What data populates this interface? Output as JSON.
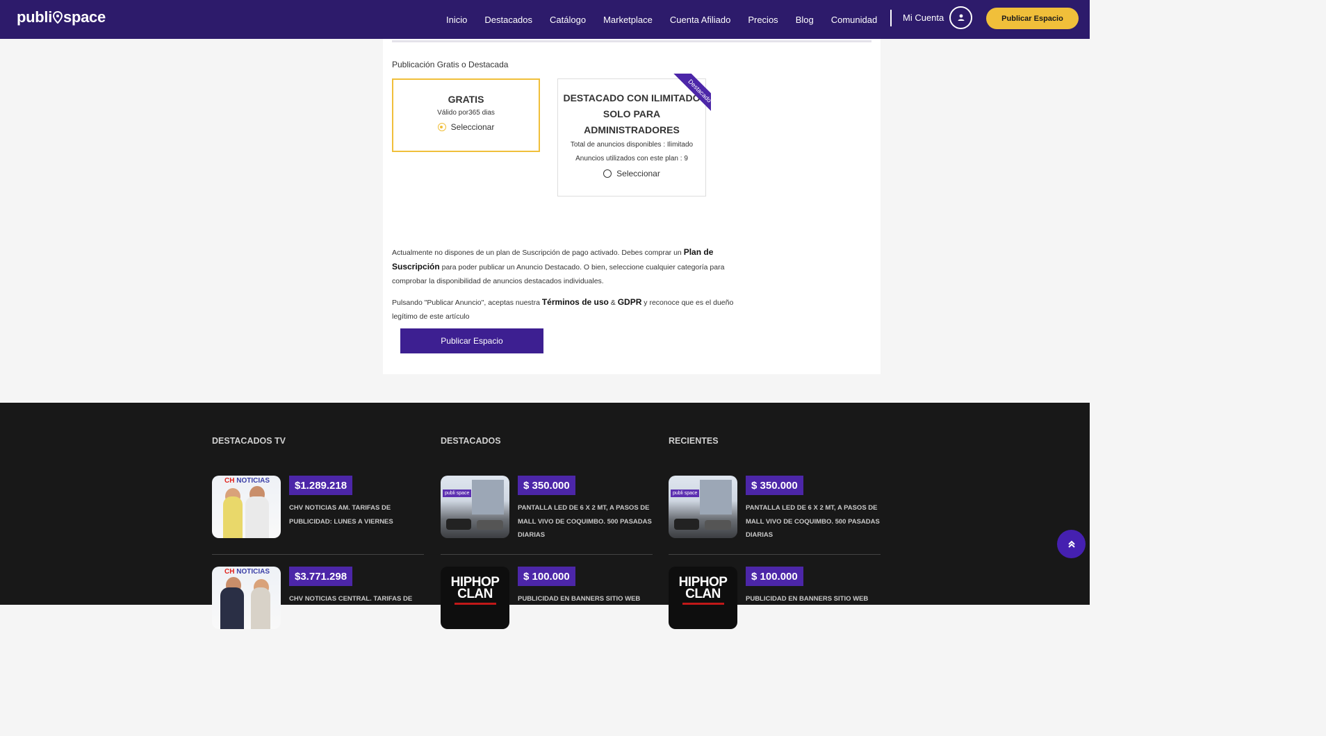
{
  "header": {
    "logo_left": "publi",
    "logo_right": "space",
    "nav": [
      "Inicio",
      "Destacados",
      "Catálogo",
      "Marketplace",
      "Cuenta Afiliado",
      "Precios",
      "Blog",
      "Comunidad"
    ],
    "account_label": "Mi Cuenta",
    "publish_button": "Publicar Espacio"
  },
  "form": {
    "section_label": "Publicación Gratis o Destacada",
    "plans": {
      "free": {
        "title": "GRATIS",
        "validity": "Válido por365 dias",
        "select_label": "Seleccionar",
        "selected": true
      },
      "featured": {
        "title": "DESTACADO CON  ILIMITADO SOLO PARA ADMINISTRADORES",
        "total_label": "Total de anuncios disponibles : Ilimitado",
        "used_label": "Anuncios utilizados con este plan : 9",
        "select_label": "Seleccionar",
        "selected": false,
        "ribbon": "Destacado"
      }
    },
    "notice_text_1": "Actualmente no dispones de un plan de Suscripción de pago activado. Debes comprar un ",
    "notice_link": "Plan de Suscripción",
    "notice_text_2": " para poder publicar un Anuncio Destacado. O bien, seleccione cualquier categoría para comprobar la disponibilidad de anuncios destacados individuales.",
    "terms_text_1": "Pulsando \"Publicar Anuncio\", aceptas nuestra ",
    "terms_link": "Términos de uso",
    "terms_amp": " & ",
    "gdpr_link": "GDPR",
    "terms_text_2": " y reconoce que es el dueño legítimo de este artículo",
    "submit_label": "Publicar Espacio"
  },
  "footer": {
    "columns": [
      {
        "title": "DESTACADOS TV",
        "items": [
          {
            "price": "$1.289.218",
            "desc": "CHV NOTICIAS AM. TARIFAS DE PUBLICIDAD: LUNES A VIERNES",
            "thumb": "tv",
            "brand": "NOTICIAS"
          },
          {
            "price": "$3.771.298",
            "desc": "CHV NOTICIAS CENTRAL. TARIFAS DE",
            "thumb": "tv-dark",
            "brand": "NOTICIAS"
          }
        ]
      },
      {
        "title": "DESTACADOS",
        "items": [
          {
            "price": "$ 350.000",
            "desc": "PANTALLA LED DE 6 X 2 MT, A PASOS DE MALL VIVO DE COQUIMBO. 500 PASADAS DIARIAS",
            "thumb": "led",
            "tag": "publi space"
          },
          {
            "price": "$ 100.000",
            "desc": "PUBLICIDAD EN BANNERS SITIO WEB",
            "thumb": "hiphop",
            "brand": "HIPHOP CLAN"
          }
        ]
      },
      {
        "title": "RECIENTES",
        "items": [
          {
            "price": "$ 350.000",
            "desc": "PANTALLA LED DE 6 X 2 MT, A PASOS DE MALL VIVO DE COQUIMBO. 500 PASADAS DIARIAS",
            "thumb": "led",
            "tag": "publi space"
          },
          {
            "price": "$ 100.000",
            "desc": "PUBLICIDAD EN BANNERS SITIO WEB",
            "thumb": "hiphop",
            "brand": "HIPHOP CLAN"
          }
        ]
      }
    ]
  },
  "colors": {
    "header_bg": "#2d1b6b",
    "accent_yellow": "#f0bf3a",
    "primary_purple": "#3d1f91",
    "price_bg": "#4c26a8",
    "footer_bg": "#181818"
  },
  "icons": {
    "avatar": "user-icon",
    "scroll_top": "double-chevron-up-icon",
    "logo_pin": "map-pin-icon"
  }
}
